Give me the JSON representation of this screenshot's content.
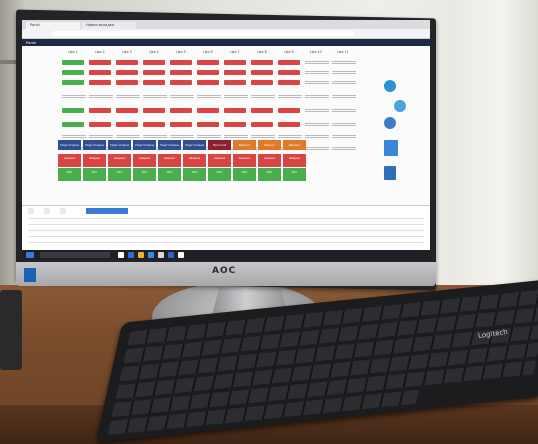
{
  "monitor": {
    "brand": "AOC"
  },
  "browser": {
    "tabs": [
      "Panel",
      "Новая вкладка"
    ],
    "url": "",
    "app_title": "Panel",
    "app_right": ""
  },
  "grid": {
    "column_headers": [
      "Цех 1",
      "Цех 2",
      "Цех 3",
      "Цех 4",
      "Цех 5",
      "Цех 6",
      "Цех 7",
      "Цех 8",
      "Цех 9",
      "Цех 10",
      "Цех 11"
    ],
    "row_labels": [
      "",
      "",
      "",
      "",
      "",
      "",
      "",
      ""
    ],
    "status_buttons": [
      {
        "label": "Подготовка",
        "color": "#2f4f8f"
      },
      {
        "label": "Подготовка",
        "color": "#2f4f8f"
      },
      {
        "label": "Подготовка",
        "color": "#2f4f8f"
      },
      {
        "label": "Подготовка",
        "color": "#2f4f8f"
      },
      {
        "label": "Подготовка",
        "color": "#2f4f8f"
      },
      {
        "label": "Подготовка",
        "color": "#2f4f8f"
      },
      {
        "label": "Простой",
        "color": "#8b1f2e"
      },
      {
        "label": "Ремонт",
        "color": "#e07a2a"
      },
      {
        "label": "Ремонт",
        "color": "#e07a2a"
      },
      {
        "label": "Ремонт",
        "color": "#e07a2a"
      }
    ],
    "repair_top": [
      "Авария",
      "Авария",
      "Авария",
      "Авария",
      "Авария",
      "Авария",
      "Авария",
      "Авария",
      "Авария",
      "Авария"
    ],
    "repair_bottom": [
      "Нет",
      "Нет",
      "Нет",
      "Нет",
      "Нет",
      "Нет",
      "Нет",
      "Нет",
      "Нет",
      "Нет"
    ]
  },
  "bottom_panel": {
    "tabs": [
      "",
      "",
      "",
      ""
    ],
    "active_tab": ""
  },
  "taskbar": {
    "search_placeholder": "",
    "time": "",
    "date": ""
  },
  "keyboard": {
    "brand": "Logitech"
  }
}
